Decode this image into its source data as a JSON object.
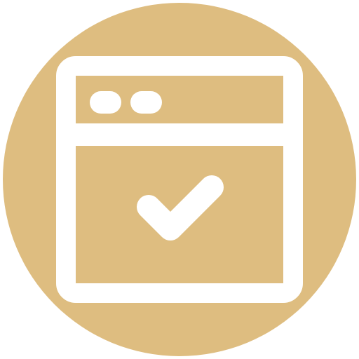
{
  "icon": {
    "name": "browser-window-check-icon",
    "colors": {
      "circle": "#DEBD80",
      "glyph": "#FFFFFF"
    },
    "parts": {
      "window": "browser-window",
      "title_bar": "title-bar",
      "window_dots": "window-dots",
      "content_area": "content-area",
      "check": "checkmark"
    }
  }
}
